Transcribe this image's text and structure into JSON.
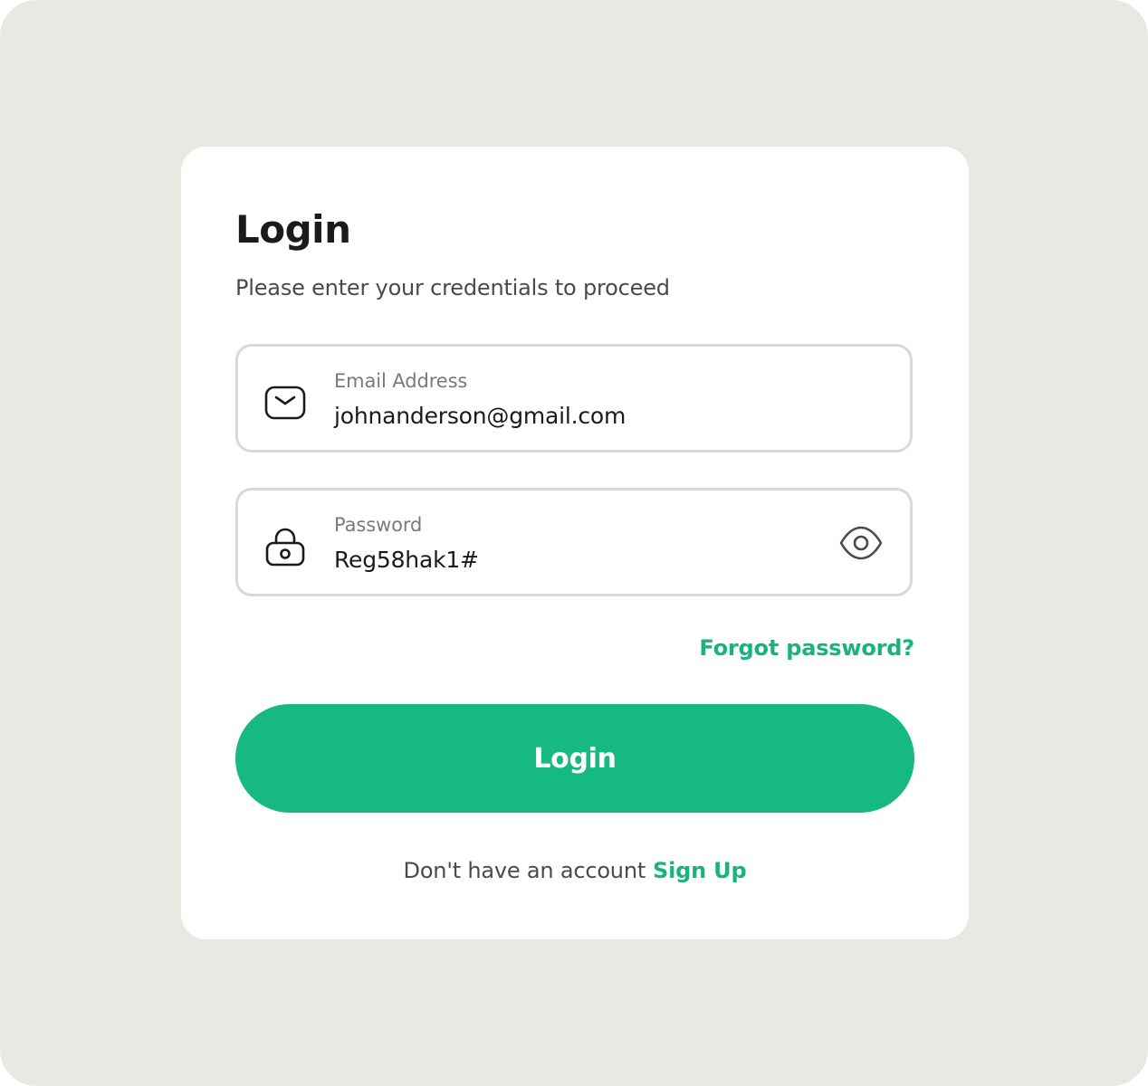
{
  "colors": {
    "page_background": "#e9e8e3",
    "card_background": "#ffffff",
    "accent": "#17b982",
    "field_border": "#d9d9d9",
    "heading": "#1b1b1b",
    "muted": "#7a7a7a"
  },
  "header": {
    "title": "Login",
    "subtitle": "Please enter your credentials to proceed"
  },
  "form": {
    "email": {
      "label": "Email Address",
      "value": "johnanderson@gmail.com",
      "icon": "envelope-icon"
    },
    "password": {
      "label": "Password",
      "value": "Reg58hak1#",
      "icon": "lock-icon",
      "toggle_icon": "eye-icon"
    },
    "forgot_label": "Forgot password?",
    "submit_label": "Login"
  },
  "footer": {
    "prompt": "Don't have an account",
    "signup_label": "Sign Up"
  }
}
